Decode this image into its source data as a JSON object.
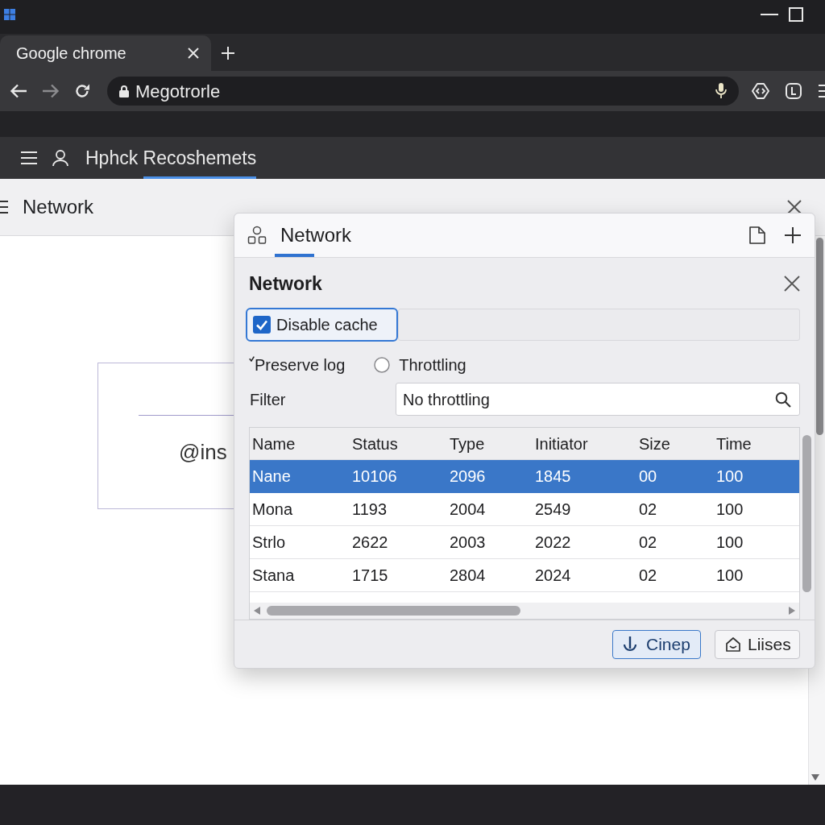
{
  "browser": {
    "tab": {
      "title": "Google chrome",
      "selected": true
    },
    "address_bar": {
      "value": "Megotrorle"
    }
  },
  "app_bar": {
    "tab": {
      "label": "Hphck Recoshemets",
      "selected": true
    }
  },
  "panel": {
    "title": "Network",
    "card": {
      "text": "@ins"
    }
  },
  "dialog": {
    "tab": {
      "label": "Network",
      "selected": true
    },
    "heading": "Network",
    "disable_cache": {
      "label": "Disable cache",
      "checked": true,
      "focused": true
    },
    "preserve_log": {
      "label": "Preserve log",
      "checked": true
    },
    "throttling": {
      "label": "Throttling",
      "selected": false
    },
    "filter": {
      "label": "Filter",
      "value": "No throttling"
    },
    "table": {
      "columns": [
        "Name",
        "Status",
        "Type",
        "Initiator",
        "Size",
        "Time"
      ],
      "rows": [
        {
          "cells": [
            "Nane",
            "10106",
            "2096",
            "1845",
            "00",
            "100"
          ],
          "selected": true
        },
        {
          "cells": [
            "Mona",
            "1193",
            "2004",
            "2549",
            "02",
            "100"
          ],
          "selected": false
        },
        {
          "cells": [
            "Strlo",
            "2622",
            "2003",
            "2022",
            "02",
            "100"
          ],
          "selected": false
        },
        {
          "cells": [
            "Stana",
            "1715",
            "2804",
            "2024",
            "02",
            "100"
          ],
          "selected": false
        }
      ]
    },
    "buttons": [
      {
        "label": "Cinep",
        "kind": "primary"
      },
      {
        "label": "Liises",
        "kind": "secondary"
      }
    ]
  }
}
